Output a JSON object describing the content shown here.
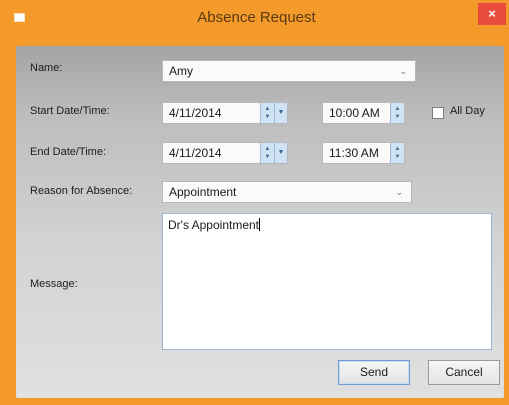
{
  "window": {
    "title": "Absence Request",
    "close_glyph": "×"
  },
  "form": {
    "name_label": "Name:",
    "name_value": "Amy",
    "start_label": "Start Date/Time:",
    "start_date": "4/11/2014",
    "start_time": "10:00 AM",
    "all_day_label": "All Day",
    "all_day_checked": false,
    "end_label": "End Date/Time:",
    "end_date": "4/11/2014",
    "end_time": "11:30 AM",
    "reason_label": "Reason for Absence:",
    "reason_value": "Appointment",
    "message_label": "Message:",
    "message_value": "Dr's Appointment"
  },
  "buttons": {
    "send": "Send",
    "cancel": "Cancel"
  },
  "icons": {
    "app": "window-icon",
    "close": "close-icon",
    "dropdown": "chevron-down-icon",
    "spinner": "spinner-arrows-icon"
  },
  "colors": {
    "frame": "#f39a2b",
    "close": "#e84c3d",
    "spinner": "#cfe3f4"
  }
}
